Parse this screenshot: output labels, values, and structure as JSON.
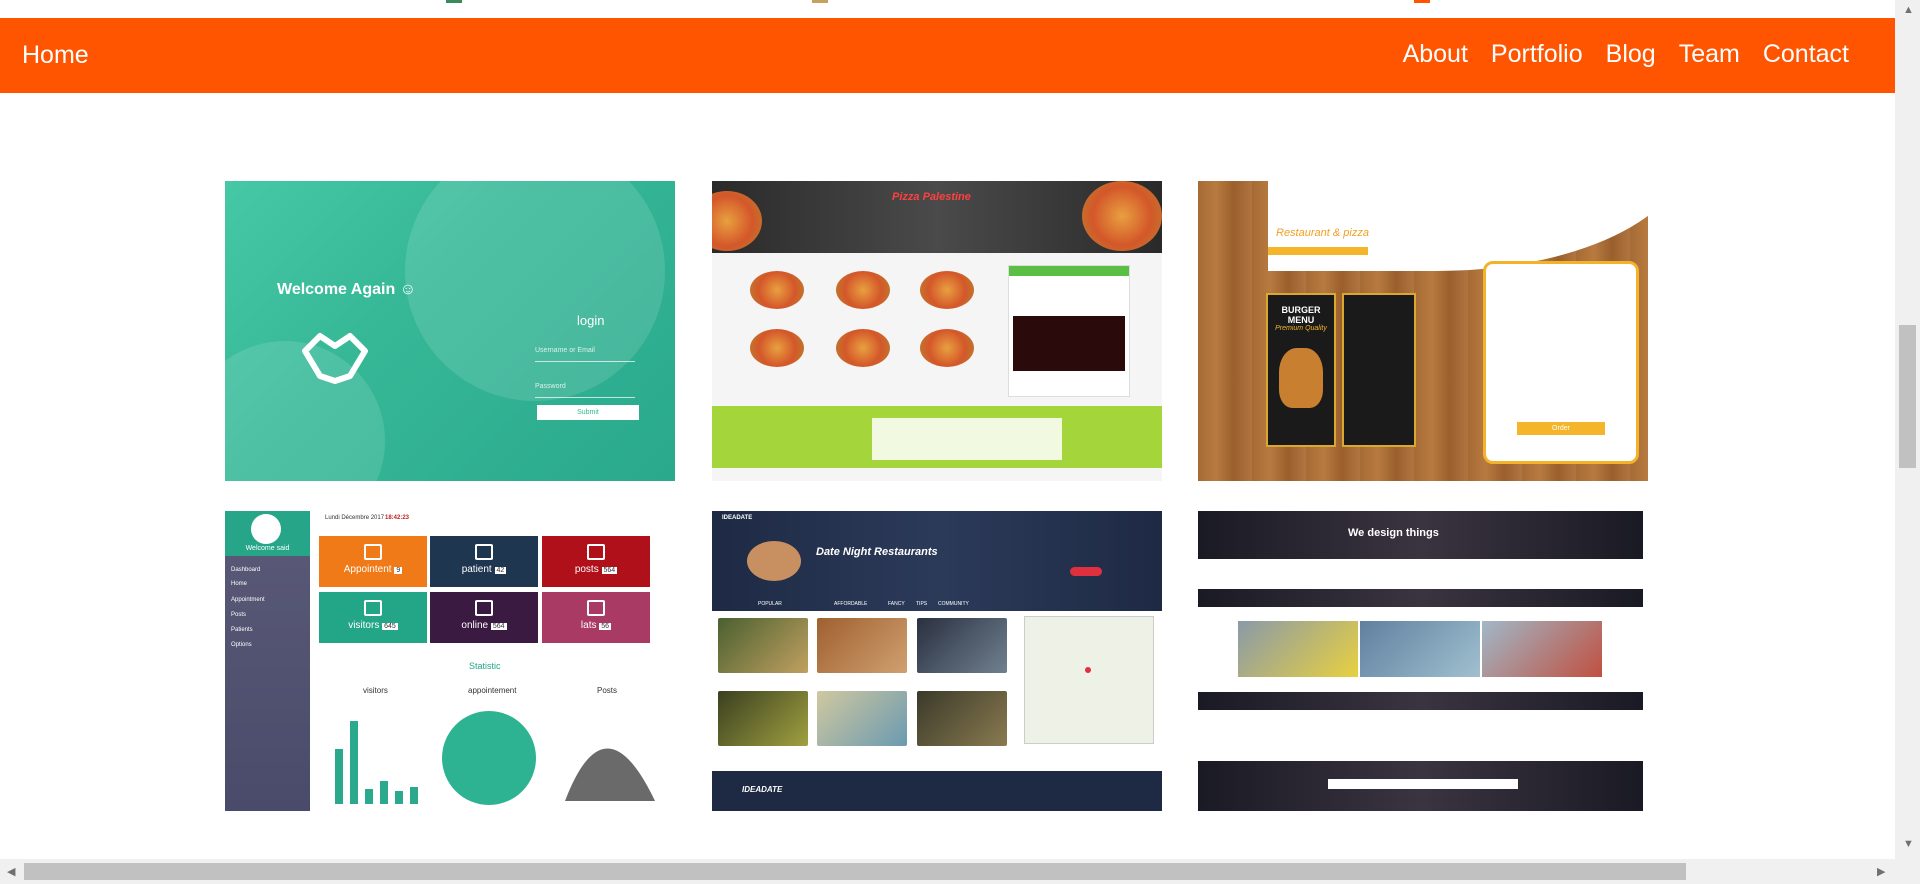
{
  "navbar": {
    "brand": "Home",
    "links": [
      "About",
      "Portfolio",
      "Blog",
      "Team",
      "Contact"
    ],
    "color": "#ff5500"
  },
  "portfolio": [
    {
      "name": "login-app",
      "welcome": "Welcome Again ☺",
      "login_title": "login",
      "username_placeholder": "Username or Email",
      "password_placeholder": "Password",
      "submit_label": "Submit"
    },
    {
      "name": "pizza-palestine",
      "title": "Pizza Palestine"
    },
    {
      "name": "restaurant-pizza",
      "title": "Restaurant & pizza",
      "menu_title": "BURGER MENU",
      "menu_subtitle": "Premium Quality",
      "order_label": "Order"
    },
    {
      "name": "dashboard",
      "welcome": "Welcome said",
      "date": "Lundi Décembre 2017",
      "time": "18:42:23",
      "sidebar_items": [
        "Dashboard",
        "Home",
        "Appointment",
        "Posts",
        "Patients",
        "Options"
      ],
      "tiles": [
        {
          "label": "Appointent",
          "count": "9",
          "color": "#f07a18"
        },
        {
          "label": "patient",
          "count": "42",
          "color": "#1e3650"
        },
        {
          "label": "posts",
          "count": "564",
          "color": "#b0101a"
        },
        {
          "label": "visitors",
          "count": "645",
          "color": "#23a587"
        },
        {
          "label": "online",
          "count": "564",
          "color": "#3a1a40"
        },
        {
          "label": "lats",
          "count": "56",
          "color": "#a83a64"
        }
      ],
      "statistic": "Statistic",
      "chart_titles": [
        "visitors",
        "appointement",
        "Posts"
      ]
    },
    {
      "name": "date-night",
      "brand": "IDEADATE",
      "title": "Date Night Restaurants",
      "menu": [
        "POPULAR",
        "AFFORDABLE",
        "FANCY",
        "TIPS",
        "COMMUNITY"
      ]
    },
    {
      "name": "we-design",
      "headline": "We design things"
    }
  ]
}
